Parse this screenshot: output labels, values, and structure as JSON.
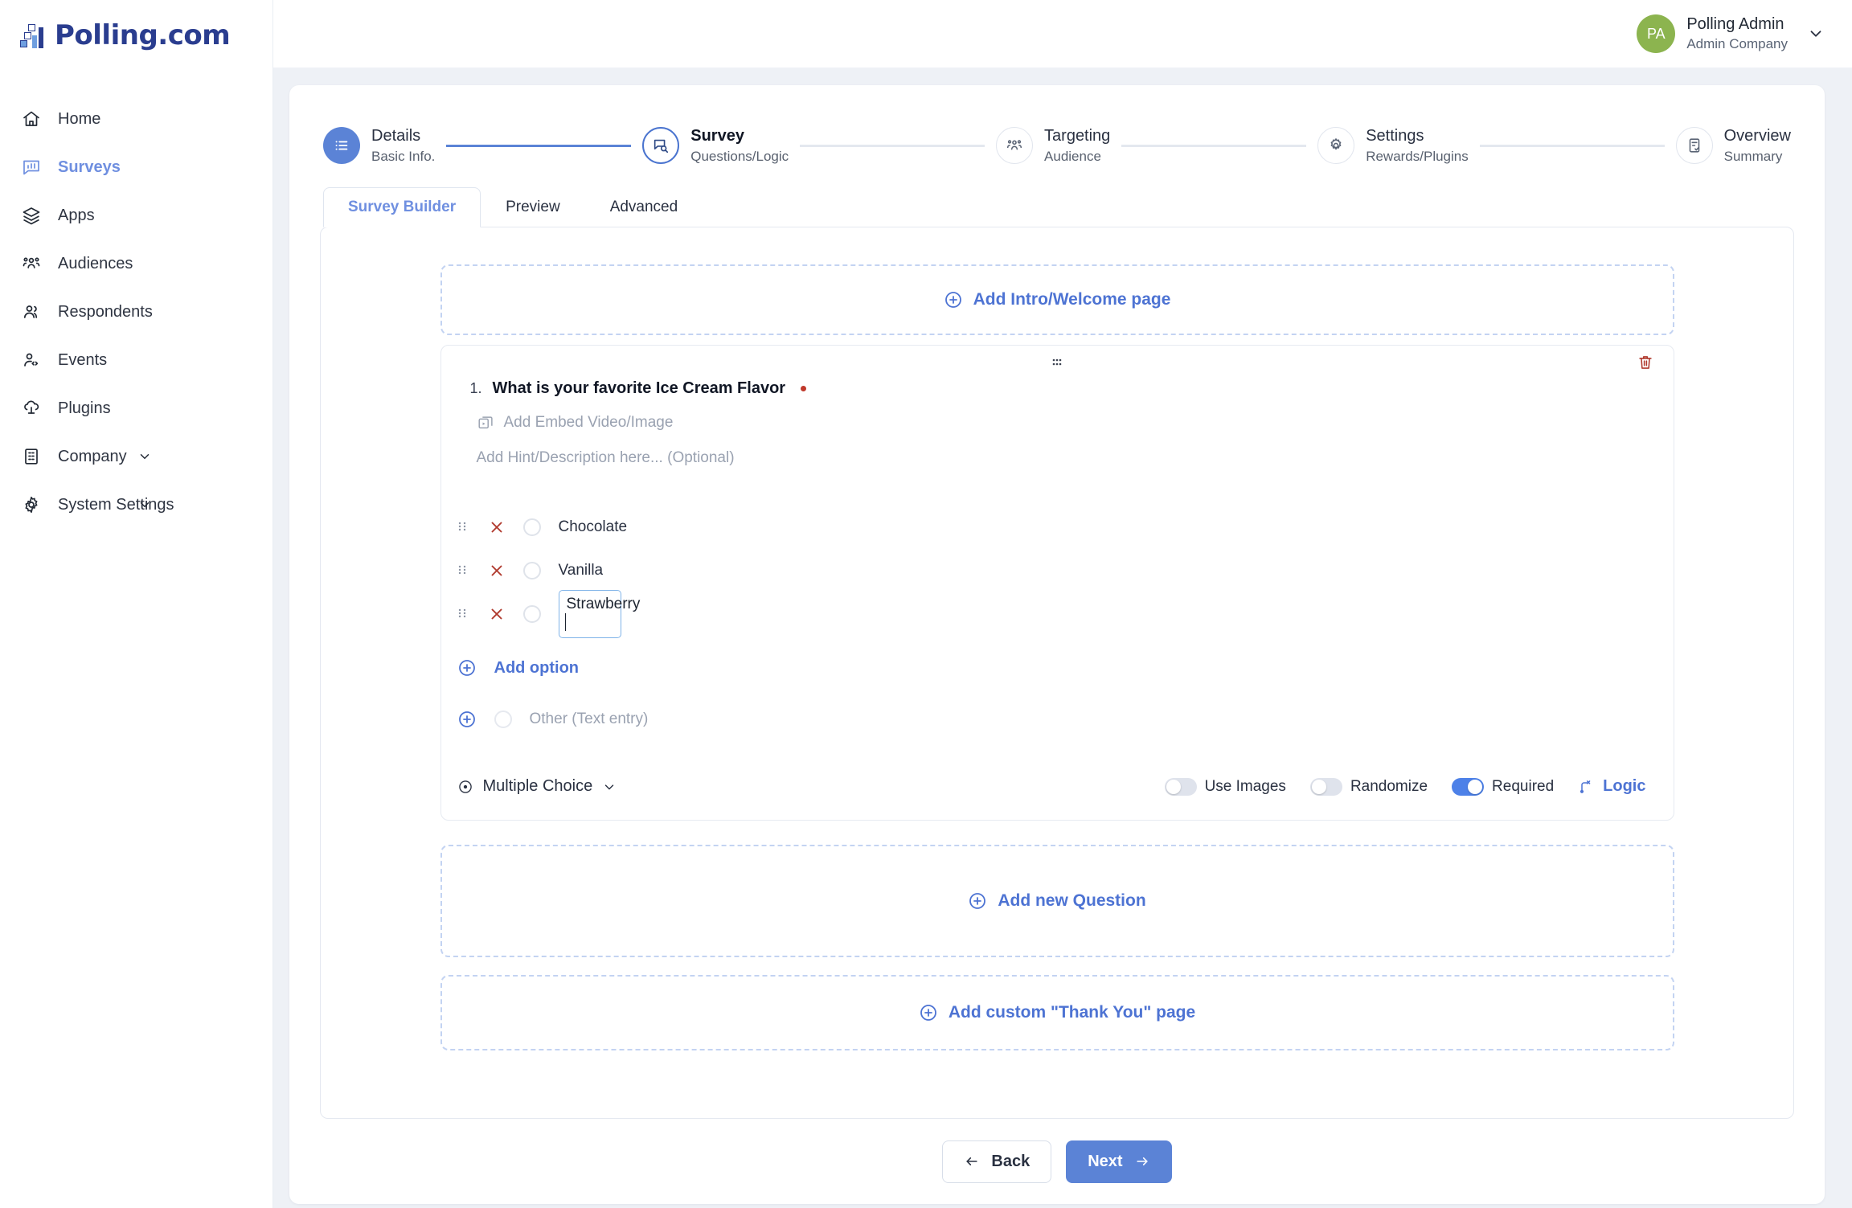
{
  "brand": {
    "name": "Polling.com",
    "logo_icon": "bar-chart-logo-icon",
    "color": "#2a3d8f"
  },
  "sidebar": {
    "items": [
      {
        "label": "Home",
        "icon": "home-icon",
        "active": false,
        "expandable": false
      },
      {
        "label": "Surveys",
        "icon": "survey-chart-icon",
        "active": true,
        "expandable": false
      },
      {
        "label": "Apps",
        "icon": "layers-icon",
        "active": false,
        "expandable": false
      },
      {
        "label": "Audiences",
        "icon": "audience-group-icon",
        "active": false,
        "expandable": false
      },
      {
        "label": "Respondents",
        "icon": "users-icon",
        "active": false,
        "expandable": false
      },
      {
        "label": "Events",
        "icon": "user-code-icon",
        "active": false,
        "expandable": false
      },
      {
        "label": "Plugins",
        "icon": "cloud-plug-icon",
        "active": false,
        "expandable": false
      },
      {
        "label": "Company",
        "icon": "building-icon",
        "active": false,
        "expandable": true
      },
      {
        "label": "System Settings",
        "icon": "gear-icon",
        "active": false,
        "expandable": true
      }
    ]
  },
  "topbar": {
    "avatar_initials": "PA",
    "avatar_color": "#8cb44f",
    "user_name": "Polling Admin",
    "user_company": "Admin Company",
    "chevron_icon": "chevron-down-icon"
  },
  "wizard": {
    "steps": [
      {
        "title": "Details",
        "subtitle": "Basic Info.",
        "icon": "list-icon",
        "state": "done"
      },
      {
        "title": "Survey",
        "subtitle": "Questions/Logic",
        "icon": "survey-search-icon",
        "state": "current"
      },
      {
        "title": "Targeting",
        "subtitle": "Audience",
        "icon": "audience-group-icon",
        "state": "idle"
      },
      {
        "title": "Settings",
        "subtitle": "Rewards/Plugins",
        "icon": "gear-icon",
        "state": "idle"
      },
      {
        "title": "Overview",
        "subtitle": "Summary",
        "icon": "clipboard-check-icon",
        "state": "idle"
      }
    ]
  },
  "tabs": [
    {
      "label": "Survey Builder",
      "active": true
    },
    {
      "label": "Preview",
      "active": false
    },
    {
      "label": "Advanced",
      "active": false
    }
  ],
  "builder": {
    "add_intro_label": "Add Intro/Welcome page",
    "add_question_label": "Add new Question",
    "add_thankyou_label": "Add custom \"Thank You\" page",
    "question": {
      "number": "1.",
      "title": "What is your favorite Ice Cream Flavor",
      "required_marker": true,
      "embed_label": "Add Embed Video/Image",
      "hint_placeholder": "Add Hint/Description here... (Optional)",
      "options": [
        {
          "label": "Chocolate",
          "editing": false
        },
        {
          "label": "Vanilla",
          "editing": false
        },
        {
          "label": "Strawberry",
          "editing": true
        }
      ],
      "add_option_label": "Add option",
      "other_label": "Other (Text entry)",
      "type_label": "Multiple Choice",
      "toggles": [
        {
          "label": "Use Images",
          "on": false
        },
        {
          "label": "Randomize",
          "on": false
        },
        {
          "label": "Required",
          "on": true
        }
      ],
      "logic_label": "Logic",
      "delete_icon": "trash-icon",
      "drag_icon": "drag-grip-icon"
    }
  },
  "footer": {
    "back_label": "Back",
    "next_label": "Next"
  },
  "colors": {
    "accent": "#5b83d6",
    "link": "#4d73d3",
    "danger": "#c0392b",
    "page_bg": "#eef1f6"
  }
}
